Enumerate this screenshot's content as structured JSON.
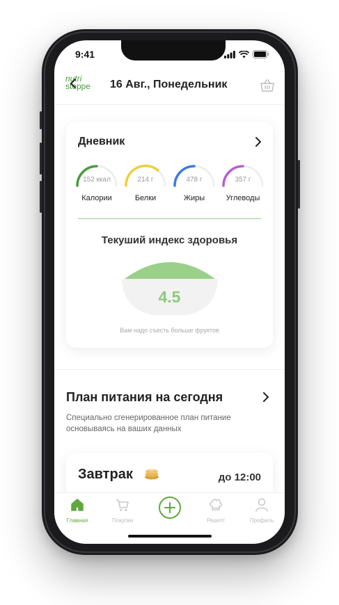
{
  "status": {
    "time": "9:41"
  },
  "header": {
    "logo_line1": "nutri",
    "logo_line2": "steppe",
    "date": "16 Авг., Понедельник"
  },
  "diary": {
    "title": "Дневник",
    "macros": [
      {
        "value": "152 ккал",
        "label": "Калории",
        "color": "#4a9b3a",
        "progress": 0.3
      },
      {
        "value": "214 г",
        "label": "Белки",
        "color": "#f0cf3a",
        "progress": 0.45
      },
      {
        "value": "478 г",
        "label": "Жиры",
        "color": "#3b7be0",
        "progress": 0.3
      },
      {
        "value": "357 г",
        "label": "Углеводы",
        "color": "#b55ed6",
        "progress": 0.3
      }
    ],
    "health_title": "Текуший индекс здоровья",
    "health_score": "4.5",
    "tip": "Вам надо съесть больше фруктов"
  },
  "plan": {
    "title": "План питания на сегодня",
    "subtitle": "Специально сгенерированное план питание основываясь на ваших данных"
  },
  "breakfast": {
    "title": "Завтрак",
    "time": "до 12:00"
  },
  "tabs": [
    {
      "label": "Главная",
      "icon": "home-icon",
      "active": true
    },
    {
      "label": "Покупки",
      "icon": "cart-icon",
      "active": false
    },
    {
      "label": "",
      "icon": "add-icon",
      "active": false
    },
    {
      "label": "Рецепт",
      "icon": "chef-hat-icon",
      "active": false
    },
    {
      "label": "Профиль",
      "icon": "profile-icon",
      "active": false
    }
  ],
  "colors": {
    "accent": "#5fa83e",
    "score": "#8cc97a",
    "bowl_fill": "#9bd08a"
  }
}
